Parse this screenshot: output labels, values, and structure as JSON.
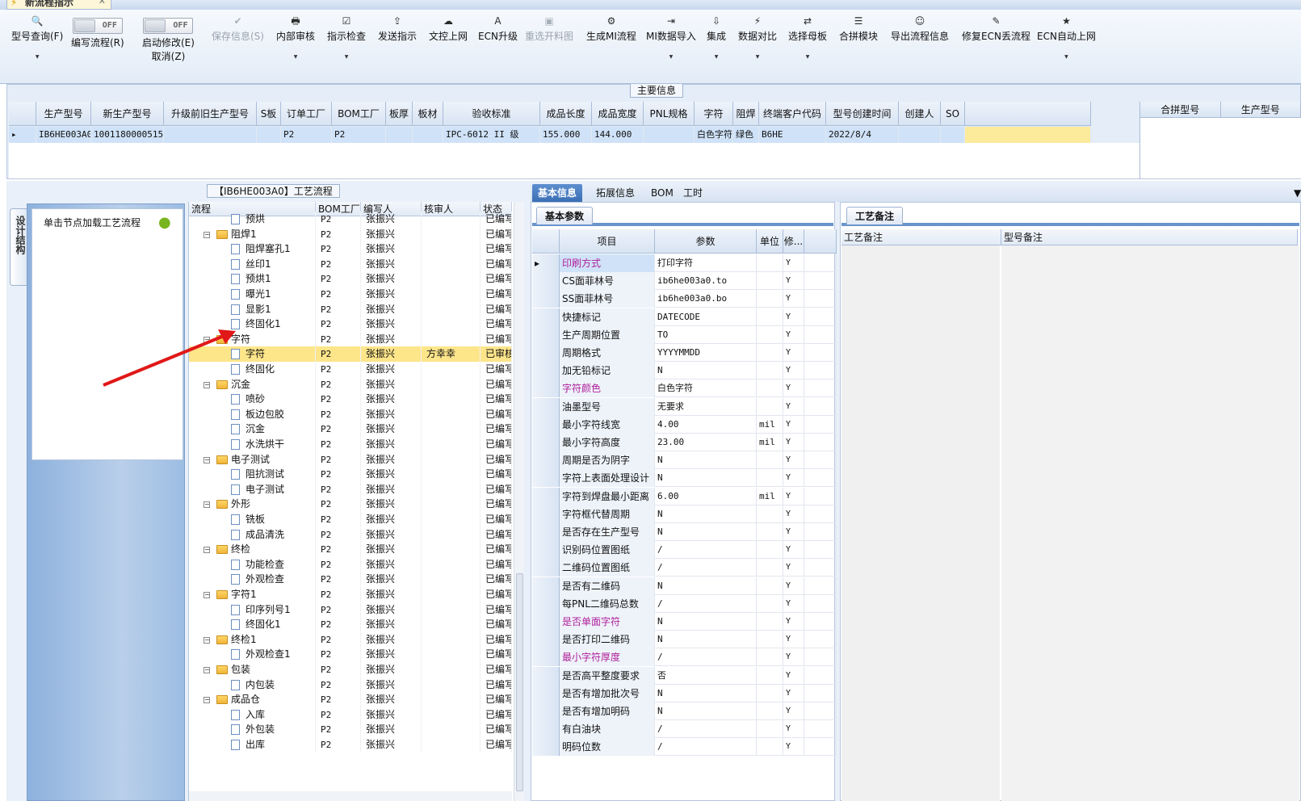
{
  "window": {
    "tab_title": "新流程指示",
    "close_glyph": "✕"
  },
  "toolbar": {
    "buttons": [
      {
        "id": "query",
        "icon": "🔍",
        "label": "型号查询(F)",
        "dropdown": true,
        "disabled": false
      },
      {
        "id": "save",
        "icon": "✔",
        "label": "保存信息(S)",
        "dropdown": false,
        "disabled": true
      },
      {
        "id": "internal",
        "icon": "🖶",
        "label": "内部审核",
        "dropdown": true,
        "disabled": false
      },
      {
        "id": "check",
        "icon": "☑",
        "label": "指示检查",
        "dropdown": true,
        "disabled": false
      },
      {
        "id": "send",
        "icon": "⇪",
        "label": "发送指示",
        "dropdown": false,
        "disabled": false
      },
      {
        "id": "upload",
        "icon": "☁",
        "label": "文控上网",
        "dropdown": false,
        "disabled": false
      },
      {
        "id": "ecn",
        "icon": "A",
        "label": "ECN升级",
        "dropdown": false,
        "disabled": false
      },
      {
        "id": "reselect",
        "icon": "▣",
        "label": "重选开料图",
        "dropdown": false,
        "disabled": true
      },
      {
        "id": "genmi",
        "icon": "⚙",
        "label": "生成MI流程",
        "dropdown": false,
        "disabled": false
      },
      {
        "id": "miimport",
        "icon": "⇥",
        "label": "MI数据导入",
        "dropdown": true,
        "disabled": false
      },
      {
        "id": "integrate",
        "icon": "⇩",
        "label": "集成",
        "dropdown": true,
        "disabled": false
      },
      {
        "id": "compare",
        "icon": "⚡",
        "label": "数据对比",
        "dropdown": true,
        "disabled": false
      },
      {
        "id": "mother",
        "icon": "⇄",
        "label": "选择母板",
        "dropdown": true,
        "disabled": false
      },
      {
        "id": "merge",
        "icon": "☰",
        "label": "合拼模块",
        "dropdown": false,
        "disabled": false
      },
      {
        "id": "export",
        "icon": "☺",
        "label": "导出流程信息",
        "dropdown": false,
        "disabled": false
      },
      {
        "id": "fixecn",
        "icon": "✎",
        "label": "修复ECN丢流程",
        "dropdown": false,
        "disabled": false
      },
      {
        "id": "ecnauto",
        "icon": "★",
        "label": "ECN自动上网",
        "dropdown": true,
        "disabled": false
      }
    ],
    "toggle_write": {
      "state": "OFF",
      "label": "编写流程(R)"
    },
    "toggle_modify": {
      "state": "OFF",
      "label": "启动修改(E)",
      "label2": "取消(Z)"
    }
  },
  "main_info": {
    "caption": "主要信息",
    "columns": [
      "生产型号",
      "新生产型号",
      "升级前旧生产型号",
      "S板",
      "订单工厂",
      "BOM工厂",
      "板厚",
      "板材",
      "验收标准",
      "成品长度",
      "成品宽度",
      "PNL规格",
      "字符",
      "阻焊",
      "终端客户代码",
      "型号创建时间",
      "创建人",
      "SO"
    ],
    "row": [
      "IB6HE003A0",
      "10011800005158",
      "",
      "",
      "P2",
      "P2",
      "",
      "",
      "IPC-6012 II 级",
      "155.000",
      "144.000",
      "",
      "白色字符",
      "绿色",
      "B6HE",
      "2022/8/4",
      "",
      ""
    ],
    "merge_columns": [
      "合拼型号",
      "生产型号"
    ]
  },
  "left_panel": {
    "side_tab": "设计结构",
    "hint": "单击节点加载工艺流程"
  },
  "process": {
    "caption": "【IB6HE003A0】工艺流程",
    "columns": [
      "流程",
      "BOM工厂",
      "编写人",
      "核审人",
      "状态"
    ],
    "rows": [
      {
        "level": 1,
        "type": "doc",
        "name": "预烘",
        "factory": "P2",
        "writer": "张振兴",
        "reviewer": "",
        "status": "已编写"
      },
      {
        "level": 0,
        "type": "folder",
        "name": "阻焊1",
        "factory": "P2",
        "writer": "张振兴",
        "reviewer": "",
        "status": "已编写"
      },
      {
        "level": 1,
        "type": "doc",
        "name": "阻焊塞孔1",
        "factory": "P2",
        "writer": "张振兴",
        "reviewer": "",
        "status": "已编写"
      },
      {
        "level": 1,
        "type": "doc",
        "name": "丝印1",
        "factory": "P2",
        "writer": "张振兴",
        "reviewer": "",
        "status": "已编写"
      },
      {
        "level": 1,
        "type": "doc",
        "name": "预烘1",
        "factory": "P2",
        "writer": "张振兴",
        "reviewer": "",
        "status": "已编写"
      },
      {
        "level": 1,
        "type": "doc",
        "name": "曝光1",
        "factory": "P2",
        "writer": "张振兴",
        "reviewer": "",
        "status": "已编写"
      },
      {
        "level": 1,
        "type": "doc",
        "name": "显影1",
        "factory": "P2",
        "writer": "张振兴",
        "reviewer": "",
        "status": "已编写"
      },
      {
        "level": 1,
        "type": "doc",
        "name": "终固化1",
        "factory": "P2",
        "writer": "张振兴",
        "reviewer": "",
        "status": "已编写"
      },
      {
        "level": 0,
        "type": "folder",
        "name": "字符",
        "factory": "P2",
        "writer": "张振兴",
        "reviewer": "",
        "status": "已编写"
      },
      {
        "level": 1,
        "type": "doc",
        "name": "字符",
        "factory": "P2",
        "writer": "张振兴",
        "reviewer": "方幸幸",
        "status": "已审核",
        "selected": true
      },
      {
        "level": 1,
        "type": "doc",
        "name": "终固化",
        "factory": "P2",
        "writer": "张振兴",
        "reviewer": "",
        "status": "已编写"
      },
      {
        "level": 0,
        "type": "folder",
        "name": "沉金",
        "factory": "P2",
        "writer": "张振兴",
        "reviewer": "",
        "status": "已编写"
      },
      {
        "level": 1,
        "type": "doc",
        "name": "喷砂",
        "factory": "P2",
        "writer": "张振兴",
        "reviewer": "",
        "status": "已编写"
      },
      {
        "level": 1,
        "type": "doc",
        "name": "板边包胶",
        "factory": "P2",
        "writer": "张振兴",
        "reviewer": "",
        "status": "已编写"
      },
      {
        "level": 1,
        "type": "doc",
        "name": "沉金",
        "factory": "P2",
        "writer": "张振兴",
        "reviewer": "",
        "status": "已编写"
      },
      {
        "level": 1,
        "type": "doc",
        "name": "水洗烘干",
        "factory": "P2",
        "writer": "张振兴",
        "reviewer": "",
        "status": "已编写"
      },
      {
        "level": 0,
        "type": "folder",
        "name": "电子测试",
        "factory": "P2",
        "writer": "张振兴",
        "reviewer": "",
        "status": "已编写"
      },
      {
        "level": 1,
        "type": "doc",
        "name": "阻抗测试",
        "factory": "P2",
        "writer": "张振兴",
        "reviewer": "",
        "status": "已编写"
      },
      {
        "level": 1,
        "type": "doc",
        "name": "电子测试",
        "factory": "P2",
        "writer": "张振兴",
        "reviewer": "",
        "status": "已编写"
      },
      {
        "level": 0,
        "type": "folder",
        "name": "外形",
        "factory": "P2",
        "writer": "张振兴",
        "reviewer": "",
        "status": "已编写"
      },
      {
        "level": 1,
        "type": "doc",
        "name": "铣板",
        "factory": "P2",
        "writer": "张振兴",
        "reviewer": "",
        "status": "已编写"
      },
      {
        "level": 1,
        "type": "doc",
        "name": "成品清洗",
        "factory": "P2",
        "writer": "张振兴",
        "reviewer": "",
        "status": "已编写"
      },
      {
        "level": 0,
        "type": "folder",
        "name": "终检",
        "factory": "P2",
        "writer": "张振兴",
        "reviewer": "",
        "status": "已编写"
      },
      {
        "level": 1,
        "type": "doc",
        "name": "功能检查",
        "factory": "P2",
        "writer": "张振兴",
        "reviewer": "",
        "status": "已编写"
      },
      {
        "level": 1,
        "type": "doc",
        "name": "外观检查",
        "factory": "P2",
        "writer": "张振兴",
        "reviewer": "",
        "status": "已编写"
      },
      {
        "level": 0,
        "type": "folder",
        "name": "字符1",
        "factory": "P2",
        "writer": "张振兴",
        "reviewer": "",
        "status": "已编写"
      },
      {
        "level": 1,
        "type": "doc",
        "name": "印序列号1",
        "factory": "P2",
        "writer": "张振兴",
        "reviewer": "",
        "status": "已编写"
      },
      {
        "level": 1,
        "type": "doc",
        "name": "终固化1",
        "factory": "P2",
        "writer": "张振兴",
        "reviewer": "",
        "status": "已编写"
      },
      {
        "level": 0,
        "type": "folder",
        "name": "终检1",
        "factory": "P2",
        "writer": "张振兴",
        "reviewer": "",
        "status": "已编写"
      },
      {
        "level": 1,
        "type": "doc",
        "name": "外观检查1",
        "factory": "P2",
        "writer": "张振兴",
        "reviewer": "",
        "status": "已编写"
      },
      {
        "level": 0,
        "type": "folder",
        "name": "包装",
        "factory": "P2",
        "writer": "张振兴",
        "reviewer": "",
        "status": "已编写"
      },
      {
        "level": 1,
        "type": "doc",
        "name": "内包装",
        "factory": "P2",
        "writer": "张振兴",
        "reviewer": "",
        "status": "已编写"
      },
      {
        "level": 0,
        "type": "folder",
        "name": "成品仓",
        "factory": "P2",
        "writer": "张振兴",
        "reviewer": "",
        "status": "已编写"
      },
      {
        "level": 1,
        "type": "doc",
        "name": "入库",
        "factory": "P2",
        "writer": "张振兴",
        "reviewer": "",
        "status": "已编写"
      },
      {
        "level": 1,
        "type": "doc",
        "name": "外包装",
        "factory": "P2",
        "writer": "张振兴",
        "reviewer": "",
        "status": "已编写"
      },
      {
        "level": 1,
        "type": "doc",
        "name": "出库",
        "factory": "P2",
        "writer": "张振兴",
        "reviewer": "",
        "status": "已编写"
      }
    ]
  },
  "right_tabs": [
    "基本信息",
    "拓展信息",
    "BOM",
    "工时"
  ],
  "basic_params": {
    "tab": "基本参数",
    "columns": [
      "项目",
      "参数",
      "单位",
      "修..."
    ],
    "rows": [
      {
        "item": "印刷方式",
        "value": "打印字符",
        "unit": "",
        "mod": "Y",
        "hl": true,
        "sel": true
      },
      {
        "item": "CS面菲林号",
        "value": "ib6he003a0.to",
        "unit": "",
        "mod": "Y"
      },
      {
        "item": "SS面菲林号",
        "value": "ib6he003a0.bo",
        "unit": "",
        "mod": "Y"
      },
      {
        "item": "快捷标记",
        "value": "DATECODE",
        "unit": "",
        "mod": "Y"
      },
      {
        "item": "生产周期位置",
        "value": "TO",
        "unit": "",
        "mod": "Y"
      },
      {
        "item": "周期格式",
        "value": "YYYYMMDD",
        "unit": "",
        "mod": "Y"
      },
      {
        "item": "加无铅标记",
        "value": "N",
        "unit": "",
        "mod": "Y"
      },
      {
        "item": "字符颜色",
        "value": "白色字符",
        "unit": "",
        "mod": "Y",
        "hl": true
      },
      {
        "item": "油墨型号",
        "value": "无要求",
        "unit": "",
        "mod": "Y"
      },
      {
        "item": "最小字符线宽",
        "value": "4.00",
        "unit": "mil",
        "mod": "Y"
      },
      {
        "item": "最小字符高度",
        "value": "23.00",
        "unit": "mil",
        "mod": "Y"
      },
      {
        "item": "周期是否为阴字",
        "value": "N",
        "unit": "",
        "mod": "Y"
      },
      {
        "item": "字符上表面处理设计",
        "value": "N",
        "unit": "",
        "mod": "Y"
      },
      {
        "item": "字符到焊盘最小距离",
        "value": "6.00",
        "unit": "mil",
        "mod": "Y"
      },
      {
        "item": "字符框代替周期",
        "value": "N",
        "unit": "",
        "mod": "Y"
      },
      {
        "item": "是否存在生产型号",
        "value": "N",
        "unit": "",
        "mod": "Y"
      },
      {
        "item": "识别码位置图纸",
        "value": "/",
        "unit": "",
        "mod": "Y"
      },
      {
        "item": "二维码位置图纸",
        "value": "/",
        "unit": "",
        "mod": "Y"
      },
      {
        "item": "是否有二维码",
        "value": "N",
        "unit": "",
        "mod": "Y"
      },
      {
        "item": "每PNL二维码总数",
        "value": "/",
        "unit": "",
        "mod": "Y"
      },
      {
        "item": "是否单面字符",
        "value": "N",
        "unit": "",
        "mod": "Y",
        "hl": true
      },
      {
        "item": "是否打印二维码",
        "value": "N",
        "unit": "",
        "mod": "Y"
      },
      {
        "item": "最小字符厚度",
        "value": "/",
        "unit": "",
        "mod": "Y",
        "hl": true
      },
      {
        "item": "是否高平整度要求",
        "value": "否",
        "unit": "",
        "mod": "Y"
      },
      {
        "item": "是否有增加批次号",
        "value": "N",
        "unit": "",
        "mod": "Y"
      },
      {
        "item": "是否有增加明码",
        "value": "N",
        "unit": "",
        "mod": "Y"
      },
      {
        "item": "有白油块",
        "value": "/",
        "unit": "",
        "mod": "Y"
      },
      {
        "item": "明码位数",
        "value": "/",
        "unit": "",
        "mod": "Y"
      }
    ]
  },
  "remarks": {
    "tab": "工艺备注",
    "columns": [
      "工艺备注",
      "型号备注"
    ]
  },
  "colors": {
    "accent": "#3b6fb5",
    "selection": "#fde58a",
    "highlight_text": "#b0209a",
    "arrow": "#e01818"
  }
}
